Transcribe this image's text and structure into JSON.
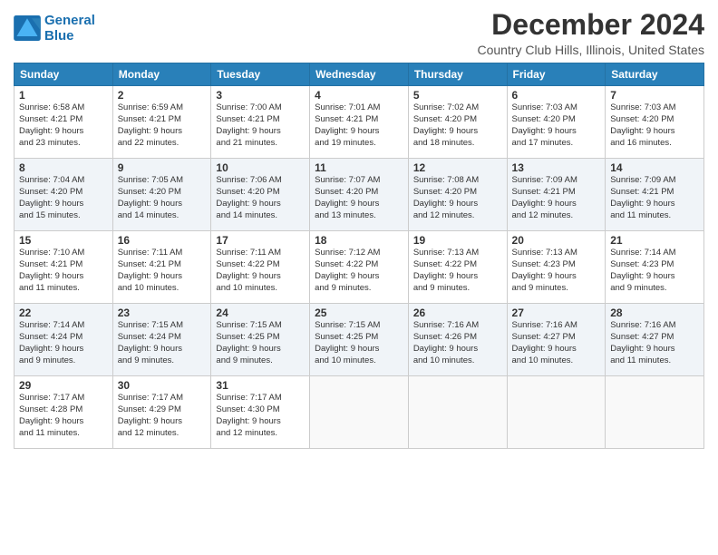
{
  "logo": {
    "line1": "General",
    "line2": "Blue"
  },
  "title": "December 2024",
  "location": "Country Club Hills, Illinois, United States",
  "days_of_week": [
    "Sunday",
    "Monday",
    "Tuesday",
    "Wednesday",
    "Thursday",
    "Friday",
    "Saturday"
  ],
  "weeks": [
    [
      {
        "day": 1,
        "info": "Sunrise: 6:58 AM\nSunset: 4:21 PM\nDaylight: 9 hours\nand 23 minutes."
      },
      {
        "day": 2,
        "info": "Sunrise: 6:59 AM\nSunset: 4:21 PM\nDaylight: 9 hours\nand 22 minutes."
      },
      {
        "day": 3,
        "info": "Sunrise: 7:00 AM\nSunset: 4:21 PM\nDaylight: 9 hours\nand 21 minutes."
      },
      {
        "day": 4,
        "info": "Sunrise: 7:01 AM\nSunset: 4:21 PM\nDaylight: 9 hours\nand 19 minutes."
      },
      {
        "day": 5,
        "info": "Sunrise: 7:02 AM\nSunset: 4:20 PM\nDaylight: 9 hours\nand 18 minutes."
      },
      {
        "day": 6,
        "info": "Sunrise: 7:03 AM\nSunset: 4:20 PM\nDaylight: 9 hours\nand 17 minutes."
      },
      {
        "day": 7,
        "info": "Sunrise: 7:03 AM\nSunset: 4:20 PM\nDaylight: 9 hours\nand 16 minutes."
      }
    ],
    [
      {
        "day": 8,
        "info": "Sunrise: 7:04 AM\nSunset: 4:20 PM\nDaylight: 9 hours\nand 15 minutes."
      },
      {
        "day": 9,
        "info": "Sunrise: 7:05 AM\nSunset: 4:20 PM\nDaylight: 9 hours\nand 14 minutes."
      },
      {
        "day": 10,
        "info": "Sunrise: 7:06 AM\nSunset: 4:20 PM\nDaylight: 9 hours\nand 14 minutes."
      },
      {
        "day": 11,
        "info": "Sunrise: 7:07 AM\nSunset: 4:20 PM\nDaylight: 9 hours\nand 13 minutes."
      },
      {
        "day": 12,
        "info": "Sunrise: 7:08 AM\nSunset: 4:20 PM\nDaylight: 9 hours\nand 12 minutes."
      },
      {
        "day": 13,
        "info": "Sunrise: 7:09 AM\nSunset: 4:21 PM\nDaylight: 9 hours\nand 12 minutes."
      },
      {
        "day": 14,
        "info": "Sunrise: 7:09 AM\nSunset: 4:21 PM\nDaylight: 9 hours\nand 11 minutes."
      }
    ],
    [
      {
        "day": 15,
        "info": "Sunrise: 7:10 AM\nSunset: 4:21 PM\nDaylight: 9 hours\nand 11 minutes."
      },
      {
        "day": 16,
        "info": "Sunrise: 7:11 AM\nSunset: 4:21 PM\nDaylight: 9 hours\nand 10 minutes."
      },
      {
        "day": 17,
        "info": "Sunrise: 7:11 AM\nSunset: 4:22 PM\nDaylight: 9 hours\nand 10 minutes."
      },
      {
        "day": 18,
        "info": "Sunrise: 7:12 AM\nSunset: 4:22 PM\nDaylight: 9 hours\nand 9 minutes."
      },
      {
        "day": 19,
        "info": "Sunrise: 7:13 AM\nSunset: 4:22 PM\nDaylight: 9 hours\nand 9 minutes."
      },
      {
        "day": 20,
        "info": "Sunrise: 7:13 AM\nSunset: 4:23 PM\nDaylight: 9 hours\nand 9 minutes."
      },
      {
        "day": 21,
        "info": "Sunrise: 7:14 AM\nSunset: 4:23 PM\nDaylight: 9 hours\nand 9 minutes."
      }
    ],
    [
      {
        "day": 22,
        "info": "Sunrise: 7:14 AM\nSunset: 4:24 PM\nDaylight: 9 hours\nand 9 minutes."
      },
      {
        "day": 23,
        "info": "Sunrise: 7:15 AM\nSunset: 4:24 PM\nDaylight: 9 hours\nand 9 minutes."
      },
      {
        "day": 24,
        "info": "Sunrise: 7:15 AM\nSunset: 4:25 PM\nDaylight: 9 hours\nand 9 minutes."
      },
      {
        "day": 25,
        "info": "Sunrise: 7:15 AM\nSunset: 4:25 PM\nDaylight: 9 hours\nand 10 minutes."
      },
      {
        "day": 26,
        "info": "Sunrise: 7:16 AM\nSunset: 4:26 PM\nDaylight: 9 hours\nand 10 minutes."
      },
      {
        "day": 27,
        "info": "Sunrise: 7:16 AM\nSunset: 4:27 PM\nDaylight: 9 hours\nand 10 minutes."
      },
      {
        "day": 28,
        "info": "Sunrise: 7:16 AM\nSunset: 4:27 PM\nDaylight: 9 hours\nand 11 minutes."
      }
    ],
    [
      {
        "day": 29,
        "info": "Sunrise: 7:17 AM\nSunset: 4:28 PM\nDaylight: 9 hours\nand 11 minutes."
      },
      {
        "day": 30,
        "info": "Sunrise: 7:17 AM\nSunset: 4:29 PM\nDaylight: 9 hours\nand 12 minutes."
      },
      {
        "day": 31,
        "info": "Sunrise: 7:17 AM\nSunset: 4:30 PM\nDaylight: 9 hours\nand 12 minutes."
      },
      null,
      null,
      null,
      null
    ]
  ]
}
